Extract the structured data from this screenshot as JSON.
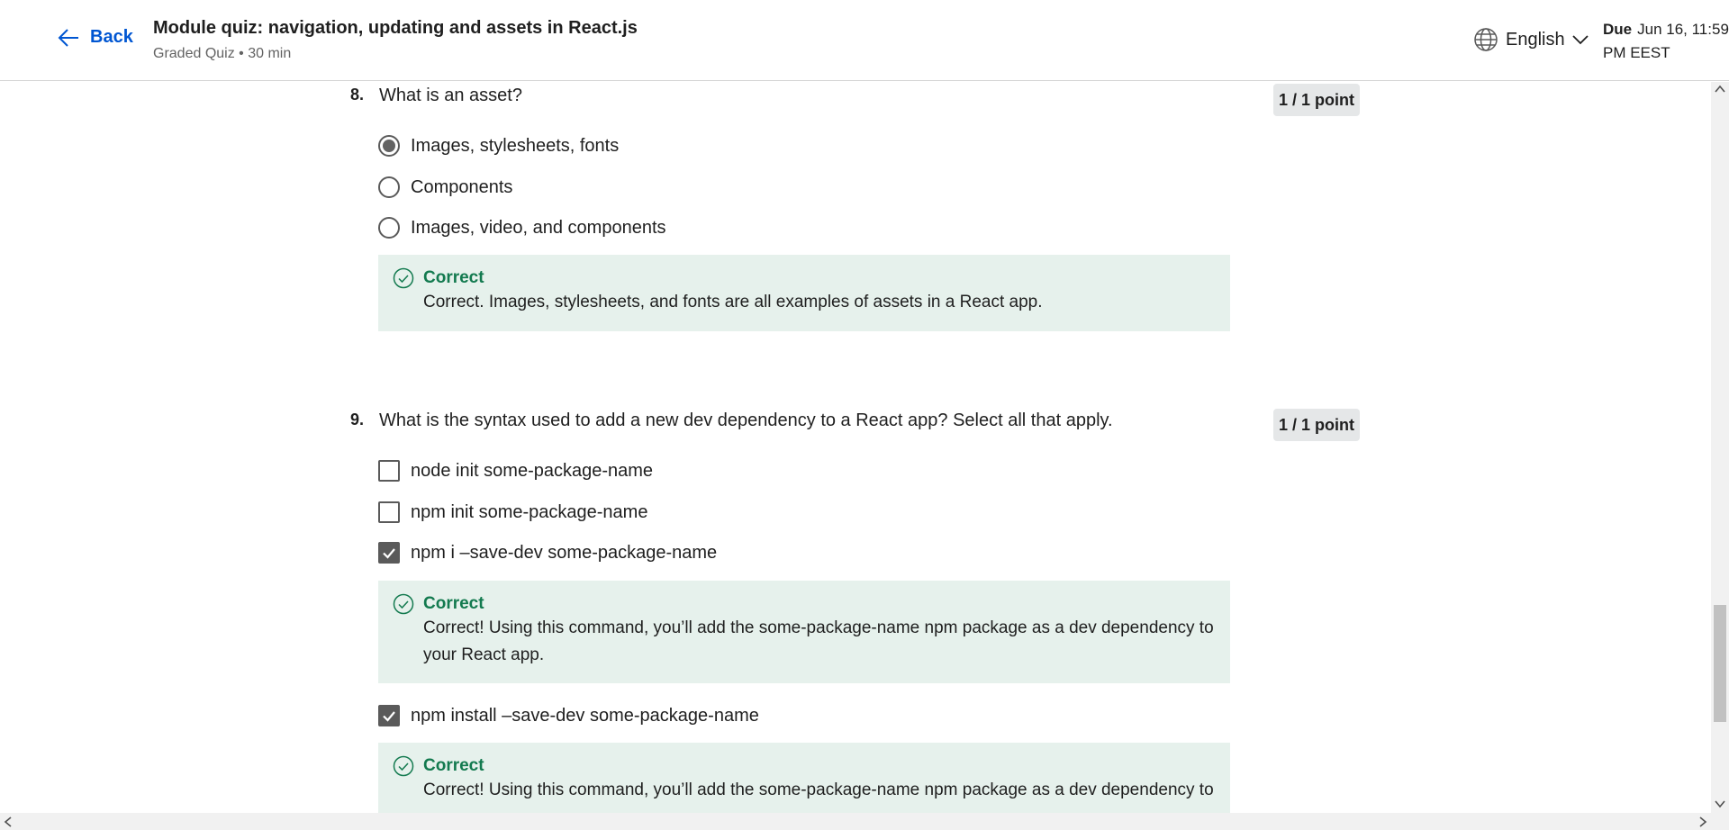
{
  "header": {
    "back_label": "Back",
    "title": "Module quiz: navigation, updating and assets in React.js",
    "subtitle": "Graded Quiz • 30 min",
    "language": "English",
    "due_label": "Due",
    "due_value": "Jun 16, 11:59 PM EEST"
  },
  "questions": [
    {
      "number": "8.",
      "text": "What is an asset?",
      "points": "1 / 1 point",
      "options": [
        {
          "label": "Images, stylesheets, fonts",
          "selected": true
        },
        {
          "label": "Components",
          "selected": false
        },
        {
          "label": "Images, video, and components",
          "selected": false
        }
      ],
      "feedback": {
        "title": "Correct",
        "body": "Correct. Images, stylesheets, and fonts are all examples of assets in a React app."
      }
    },
    {
      "number": "9.",
      "text": "What is the syntax used to add a new dev dependency to a React app? Select all that apply.",
      "points": "1 / 1 point",
      "options": [
        {
          "label": "node init some-package-name",
          "checked": false
        },
        {
          "label": "npm init some-package-name",
          "checked": false
        },
        {
          "label": "npm i –save-dev some-package-name",
          "checked": true
        },
        {
          "label": "npm install –save-dev some-package-name",
          "checked": true
        }
      ],
      "feedback": [
        {
          "title": "Correct",
          "body": "Correct! Using this command, you’ll add the some-package-name npm package as a dev dependency to your React app."
        },
        {
          "title": "Correct",
          "body": "Correct! Using this command, you’ll add the some-package-name npm package as a dev dependency to"
        }
      ]
    }
  ],
  "colors": {
    "link_blue": "#0056d2",
    "correct_green": "#137a4f",
    "feedback_bg": "#e6f1ec"
  },
  "icons": {
    "back": "arrow-left-icon",
    "language": "globe-icon",
    "dropdown": "chevron-down-icon",
    "correct": "check-circle-icon"
  }
}
